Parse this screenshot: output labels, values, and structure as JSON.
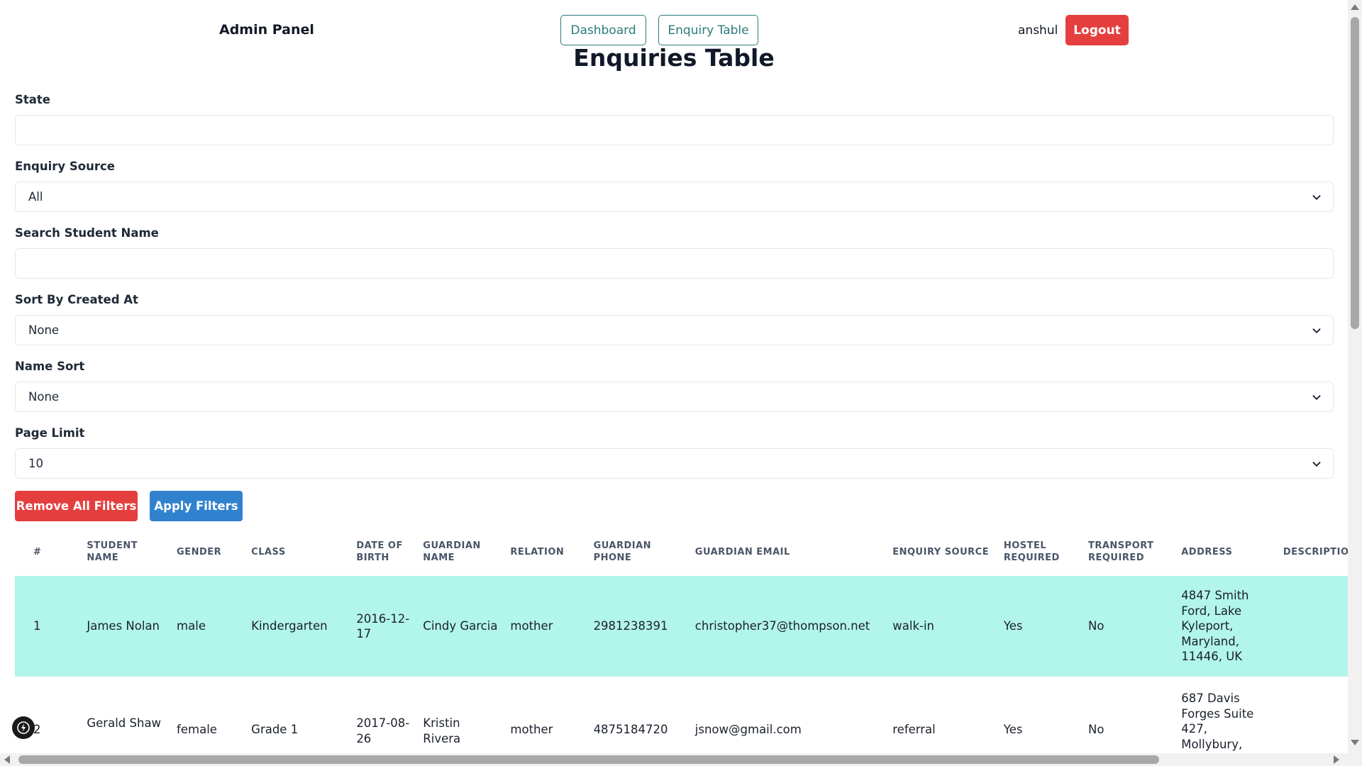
{
  "header": {
    "brand": "Admin Panel",
    "nav": {
      "dashboard": "Dashboard",
      "enquiry_table": "Enquiry Table"
    },
    "username": "anshul",
    "logout": "Logout",
    "accent_color": "#2c7a7b",
    "logout_color": "#e53e3e"
  },
  "page_title": "Enquiries Table",
  "filters": {
    "state": {
      "label": "State",
      "value": ""
    },
    "enquiry_source": {
      "label": "Enquiry Source",
      "value": "All"
    },
    "search_student": {
      "label": "Search Student Name",
      "value": ""
    },
    "sort_created": {
      "label": "Sort By Created At",
      "value": "None"
    },
    "name_sort": {
      "label": "Name Sort",
      "value": "None"
    },
    "page_limit": {
      "label": "Page Limit",
      "value": "10"
    }
  },
  "buttons": {
    "remove": "Remove All Filters",
    "apply": "Apply Filters"
  },
  "table": {
    "columns": [
      "#",
      "Student Name",
      "Gender",
      "Class",
      "Date of Birth",
      "Guardian Name",
      "Relation",
      "Guardian Phone",
      "Guardian Email",
      "Enquiry Source",
      "Hostel Required",
      "Transport Required",
      "Address",
      "Description"
    ],
    "rows": [
      [
        "1",
        "James Nolan",
        "male",
        "Kindergarten",
        "2016-12-17",
        "Cindy Garcia",
        "mother",
        "2981238391",
        "christopher37@thompson.net",
        "walk-in",
        "Yes",
        "No",
        "4847 Smith Ford, Lake Kyleport, Maryland, 11446, UK",
        ""
      ],
      [
        "2",
        "Gerald Shaw",
        "female",
        "Grade 1",
        "2017-08-26",
        "Kristin Rivera",
        "mother",
        "4875184720",
        "jsnow@gmail.com",
        "referral",
        "Yes",
        "No",
        "687 Davis Forges Suite 427, Mollybury,",
        ""
      ]
    ],
    "highlight_color": "#b2f5ea"
  },
  "icons": {
    "select_chevron": "chevron-down-icon",
    "fab": "lightning-icon"
  }
}
